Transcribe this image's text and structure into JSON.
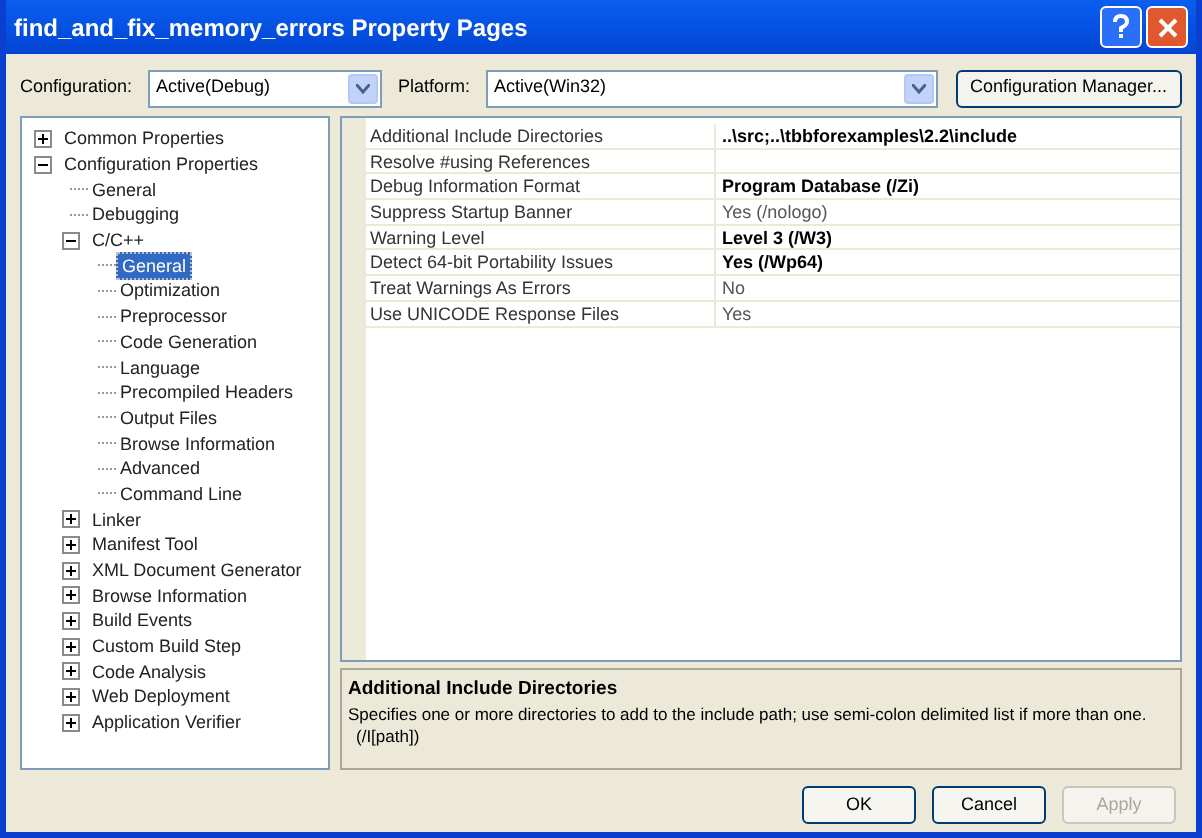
{
  "window": {
    "title": "find_and_fix_memory_errors Property Pages"
  },
  "configuration": {
    "label": "Configuration:",
    "value": "Active(Debug)"
  },
  "platform": {
    "label": "Platform:",
    "value": "Active(Win32)"
  },
  "config_manager_button": "Configuration Manager...",
  "tree": [
    {
      "label": "Common Properties",
      "expanded": false,
      "selected": false
    },
    {
      "label": "Configuration Properties",
      "expanded": true,
      "selected": false,
      "children": [
        {
          "label": "General",
          "selected": false
        },
        {
          "label": "Debugging",
          "selected": false
        },
        {
          "label": "C/C++",
          "expanded": true,
          "selected": false,
          "children": [
            {
              "label": "General",
              "selected": true
            },
            {
              "label": "Optimization",
              "selected": false
            },
            {
              "label": "Preprocessor",
              "selected": false
            },
            {
              "label": "Code Generation",
              "selected": false
            },
            {
              "label": "Language",
              "selected": false
            },
            {
              "label": "Precompiled Headers",
              "selected": false
            },
            {
              "label": "Output Files",
              "selected": false
            },
            {
              "label": "Browse Information",
              "selected": false
            },
            {
              "label": "Advanced",
              "selected": false
            },
            {
              "label": "Command Line",
              "selected": false
            }
          ]
        },
        {
          "label": "Linker",
          "expanded": false,
          "selected": false
        },
        {
          "label": "Manifest Tool",
          "expanded": false,
          "selected": false
        },
        {
          "label": "XML Document Generator",
          "expanded": false,
          "selected": false
        },
        {
          "label": "Browse Information",
          "expanded": false,
          "selected": false
        },
        {
          "label": "Build Events",
          "expanded": false,
          "selected": false
        },
        {
          "label": "Custom Build Step",
          "expanded": false,
          "selected": false
        },
        {
          "label": "Code Analysis",
          "expanded": false,
          "selected": false
        },
        {
          "label": "Web Deployment",
          "expanded": false,
          "selected": false
        },
        {
          "label": "Application Verifier",
          "expanded": false,
          "selected": false
        }
      ]
    }
  ],
  "properties": [
    {
      "name": "Additional Include Directories",
      "value": "..\\src;..\\tbbforexamples\\2.2\\include",
      "modified": true
    },
    {
      "name": "Resolve #using References"
    },
    {
      "name": "Debug Information Format",
      "value": "Program Database (/Zi)",
      "modified": true
    },
    {
      "name": "Suppress Startup Banner",
      "value": "Yes (/nologo)",
      "modified": false
    },
    {
      "name": "Warning Level",
      "value": "Level 3 (/W3)",
      "modified": true
    },
    {
      "name": "Detect 64-bit Portability Issues",
      "value": "Yes (/Wp64)",
      "modified": true
    },
    {
      "name": "Treat Warnings As Errors",
      "value": "No",
      "modified": false
    },
    {
      "name": "Use UNICODE Response Files",
      "value": "Yes",
      "modified": false
    }
  ],
  "description": {
    "title": "Additional Include Directories",
    "text": "Specifies one or more directories to add to the include path; use semi-colon delimited list if more than one.",
    "switch": "(/I[path])"
  },
  "buttons": [
    {
      "label": "OK",
      "disabled": false
    },
    {
      "label": "Cancel",
      "disabled": false
    },
    {
      "label": "Apply",
      "disabled": true
    }
  ]
}
